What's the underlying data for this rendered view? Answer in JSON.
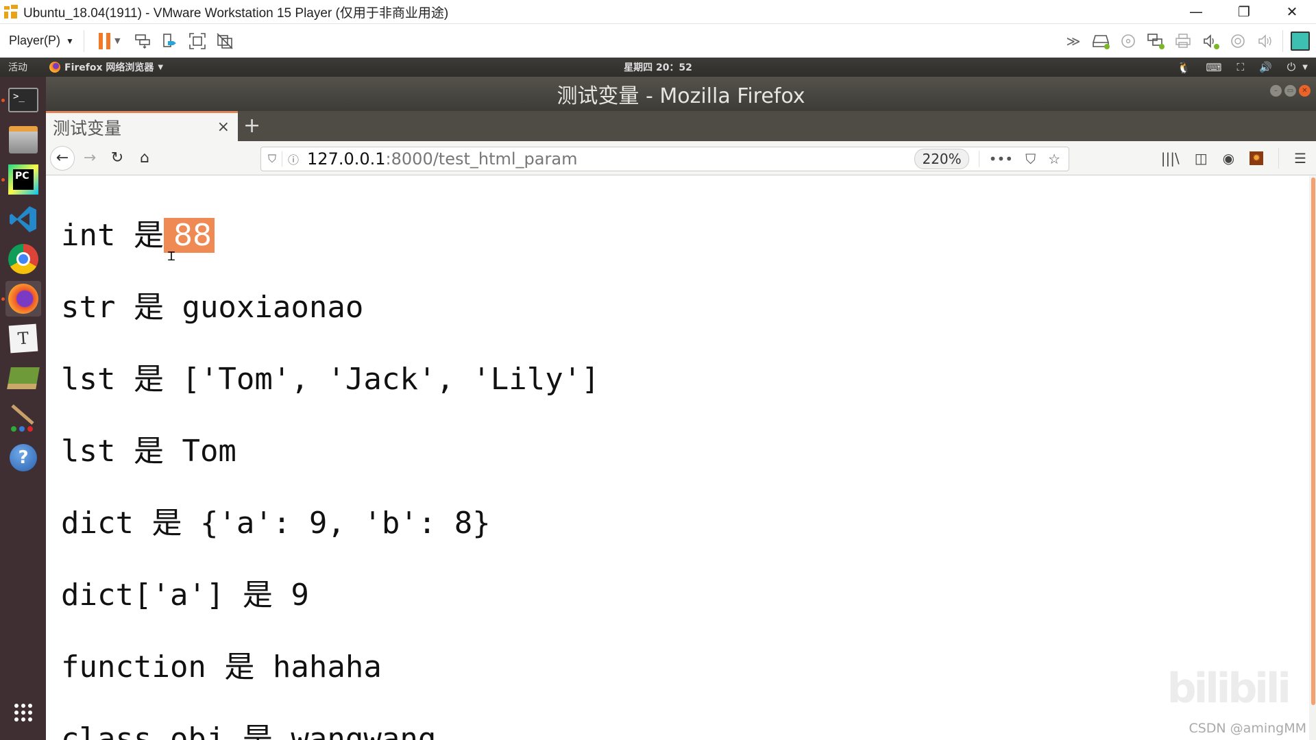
{
  "vm_window": {
    "title": "Ubuntu_18.04(1911) - VMware Workstation 15 Player (仅用于非商业用途)",
    "controls": {
      "minimize": "—",
      "restore": "❐",
      "close": "✕"
    }
  },
  "vm_toolbar": {
    "player_menu": "Player(P)",
    "left_icons": [
      "pause-icon",
      "send-ctrl-alt-del-icon",
      "removable-devices-icon",
      "fullscreen-icon",
      "unity-icon"
    ],
    "right_icons": [
      "more-chevrons-icon",
      "hard-disk-icon",
      "cd-dvd-icon",
      "network-adapter-icon",
      "printer-icon",
      "sound-card-icon",
      "camera-icon",
      "audio-icon",
      "message-log-icon"
    ]
  },
  "ubuntu_topbar": {
    "activities": "活动",
    "app_menu": "Firefox 网络浏览器",
    "clock": "星期四 20：52"
  },
  "dock": {
    "items": [
      {
        "name": "terminal",
        "label": ">_"
      },
      {
        "name": "files",
        "label": ""
      },
      {
        "name": "pycharm",
        "label": "PC"
      },
      {
        "name": "vscode",
        "label": ""
      },
      {
        "name": "chrome",
        "label": ""
      },
      {
        "name": "firefox",
        "label": ""
      },
      {
        "name": "text-editor",
        "label": "T"
      },
      {
        "name": "books",
        "label": ""
      },
      {
        "name": "paint",
        "label": ""
      },
      {
        "name": "help",
        "label": "?"
      }
    ],
    "show_apps": "⋮⋮⋮"
  },
  "firefox": {
    "window_title": "测试变量 - Mozilla Firefox",
    "tab": {
      "title": "测试变量",
      "close": "×"
    },
    "new_tab": "+",
    "url": {
      "host": "127.0.0.1",
      "rest": ":8000/test_html_param"
    },
    "zoom": "220%",
    "url_actions": {
      "more": "•••",
      "pocket": "⛉",
      "bookmark": "☆"
    },
    "toolbar_right": {
      "library": "|||\\",
      "sidebar": "◫",
      "account": "◉",
      "extension": "✹",
      "menu": "☰"
    }
  },
  "page": {
    "lines": [
      {
        "prefix": "int 是",
        "selected": "88"
      },
      {
        "text": "str 是 guoxiaonao"
      },
      {
        "text": "lst 是 ['Tom', 'Jack', 'Lily']"
      },
      {
        "text": "lst 是 Tom"
      },
      {
        "text": "dict 是 {'a': 9, 'b': 8}"
      },
      {
        "text": "dict['a'] 是 9"
      },
      {
        "text": "function 是 hahaha"
      },
      {
        "text": "class_obj 是 wangwang"
      }
    ],
    "watermark": "CSDN @amingMM",
    "bili_watermark": "bilibili"
  }
}
